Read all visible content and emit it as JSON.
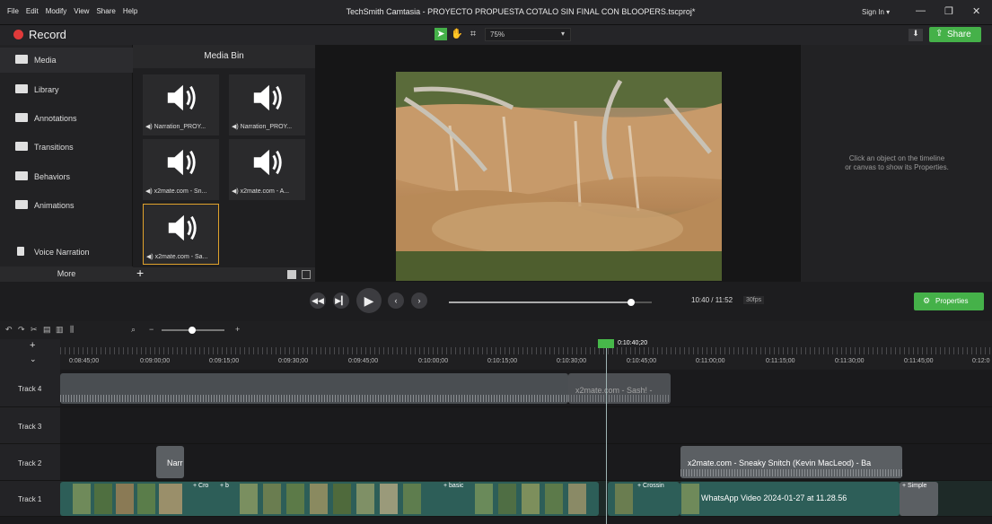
{
  "menu": [
    "File",
    "Edit",
    "Modify",
    "View",
    "Share",
    "Help"
  ],
  "app_title": "TechSmith Camtasia - PROYECTO PROPUESTA COTALO SIN FINAL CON BLOOPERS.tscproj*",
  "sign_in": "Sign In ▾",
  "record_label": "Record",
  "zoom_level": "75%",
  "share_label": "Share",
  "sidebar": {
    "items": [
      {
        "label": "Media",
        "icon": "media-icon"
      },
      {
        "label": "Library",
        "icon": "library-icon"
      },
      {
        "label": "Annotations",
        "icon": "annotations-icon"
      },
      {
        "label": "Transitions",
        "icon": "transitions-icon"
      },
      {
        "label": "Behaviors",
        "icon": "behaviors-icon"
      },
      {
        "label": "Animations",
        "icon": "animations-icon"
      },
      {
        "label": "Voice Narration",
        "icon": "microphone-icon"
      }
    ],
    "more_label": "More"
  },
  "media_bin": {
    "title": "Media Bin",
    "items": [
      {
        "caption": "◀) Narration_PROY..."
      },
      {
        "caption": "◀) Narration_PROY..."
      },
      {
        "caption": "◀) x2mate.com - Sn..."
      },
      {
        "caption": "◀) x2mate.com - A..."
      },
      {
        "caption": "◀) x2mate.com - Sa..."
      }
    ]
  },
  "properties": {
    "message_line1": "Click an object on the timeline",
    "message_line2": "or canvas to show its Properties.",
    "button_label": "Properties"
  },
  "playback": {
    "time": "10:40 / 11:52",
    "fps": "30fps",
    "progress": 0.9
  },
  "timeline": {
    "playhead_time": "0:10:40;20",
    "ticks": [
      "0:08:45;00",
      "0:09:00;00",
      "0:09:15;00",
      "0:09:30;00",
      "0:09:45;00",
      "0:10:00;00",
      "0:10:15;00",
      "0:10:30;00",
      "0:10:45;00",
      "0:11:00;00",
      "0:11:15;00",
      "0:11:30;00",
      "0:11:45;00",
      "0:12:0"
    ],
    "tracks": [
      {
        "label": "Track 4"
      },
      {
        "label": "Track 3"
      },
      {
        "label": "Track 2"
      },
      {
        "label": "Track 1"
      }
    ],
    "clips": {
      "t4_clip_label": "x2mate.com - Sash! -",
      "t2_narr_label": "Narr",
      "t2_clip_label": "x2mate.com - Sneaky Snitch (Kevin MacLeod) - Ba",
      "t1_cro": "+ Cro",
      "t1_b": "+ b",
      "t1_basic": "+ basic",
      "t1_crossin": "+ Crossin",
      "t1_whatsapp": "WhatsApp Video 2024-01-27 at 11.28.56",
      "t1_simple": "+ Simple"
    }
  }
}
